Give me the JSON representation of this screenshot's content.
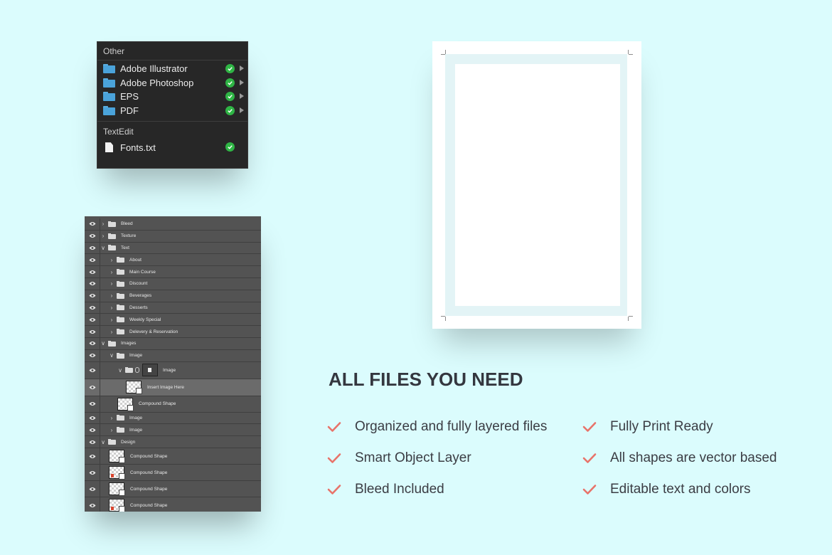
{
  "finder": {
    "section_other": "Other",
    "folders": [
      {
        "label": "Adobe Illustrator"
      },
      {
        "label": "Adobe Photoshop"
      },
      {
        "label": "EPS"
      },
      {
        "label": "PDF"
      }
    ],
    "section_textedit": "TextEdit",
    "file": {
      "label": "Fonts.txt"
    }
  },
  "layers": [
    {
      "label": "Bleed",
      "depth": 0,
      "kind": "folder",
      "expanded": false
    },
    {
      "label": "Texture",
      "depth": 0,
      "kind": "folder",
      "expanded": false
    },
    {
      "label": "Text",
      "depth": 0,
      "kind": "folder",
      "expanded": true
    },
    {
      "label": "About",
      "depth": 1,
      "kind": "folder",
      "expanded": false
    },
    {
      "label": "Main Course",
      "depth": 1,
      "kind": "folder",
      "expanded": false
    },
    {
      "label": "Discount",
      "depth": 1,
      "kind": "folder",
      "expanded": false
    },
    {
      "label": "Beverages",
      "depth": 1,
      "kind": "folder",
      "expanded": false
    },
    {
      "label": "Desserts",
      "depth": 1,
      "kind": "folder",
      "expanded": false
    },
    {
      "label": "Weekly Special",
      "depth": 1,
      "kind": "folder",
      "expanded": false
    },
    {
      "label": "Delevery & Reservation",
      "depth": 1,
      "kind": "folder",
      "expanded": false
    },
    {
      "label": "Images",
      "depth": 0,
      "kind": "folder",
      "expanded": true
    },
    {
      "label": "Image",
      "depth": 1,
      "kind": "folder",
      "expanded": true
    },
    {
      "label": "Image",
      "depth": 2,
      "kind": "masked-folder",
      "expanded": true
    },
    {
      "label": "Insert Image Here",
      "depth": 3,
      "kind": "smart-object",
      "selected": true
    },
    {
      "label": "Compound Shape",
      "depth": 2,
      "kind": "shape"
    },
    {
      "label": "Image",
      "depth": 1,
      "kind": "folder",
      "expanded": false
    },
    {
      "label": "Image",
      "depth": 1,
      "kind": "folder",
      "expanded": false
    },
    {
      "label": "Design",
      "depth": 0,
      "kind": "folder",
      "expanded": true
    },
    {
      "label": "Compound Shape",
      "depth": 1,
      "kind": "shape"
    },
    {
      "label": "Compound Shape",
      "depth": 1,
      "kind": "shape-red"
    },
    {
      "label": "Compound Shape",
      "depth": 1,
      "kind": "shape"
    },
    {
      "label": "Compound Shape",
      "depth": 1,
      "kind": "shape-red"
    }
  ],
  "features": {
    "title": "ALL FILES YOU NEED",
    "items": [
      {
        "label": "Organized and fully layered files"
      },
      {
        "label": "Smart Object Layer"
      },
      {
        "label": "Bleed Included"
      },
      {
        "label": "Fully Print Ready"
      },
      {
        "label": "All shapes are vector based"
      },
      {
        "label": "Editable text and colors"
      }
    ]
  },
  "colors": {
    "background": "#dbfcfd",
    "check_accent": "#e8736a",
    "finder_check": "#2fb545",
    "folder_blue": "#4aa3da"
  }
}
